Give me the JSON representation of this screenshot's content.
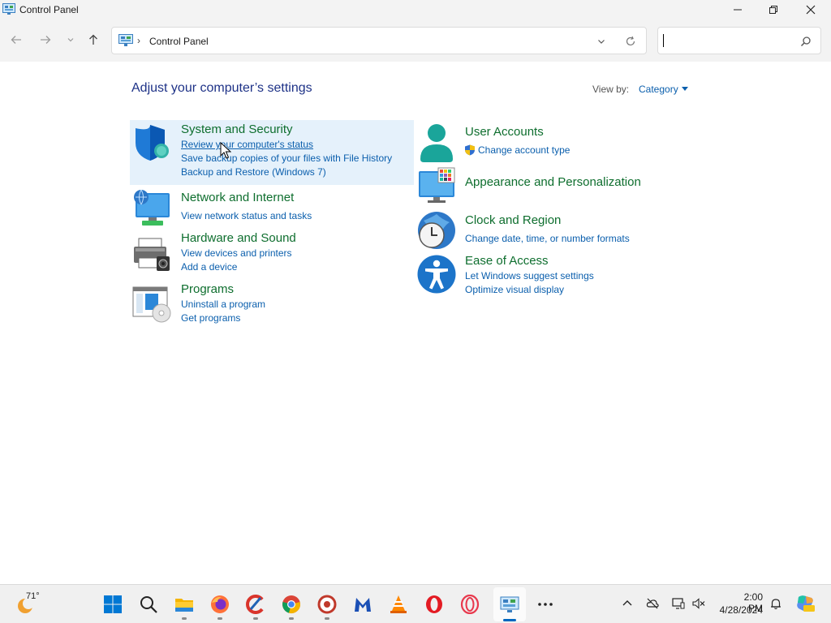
{
  "window": {
    "title": "Control Panel"
  },
  "address": {
    "crumb": "Control Panel",
    "separator": "›"
  },
  "search": {
    "placeholder": "",
    "value": ""
  },
  "main": {
    "heading": "Adjust your computer’s settings",
    "view_by_label": "View by:",
    "view_by_value": "Category"
  },
  "categories": {
    "system_security": {
      "title": "System and Security",
      "links": [
        "Review your computer's status",
        "Save backup copies of your files with File History",
        "Backup and Restore (Windows 7)"
      ]
    },
    "network": {
      "title": "Network and Internet",
      "links": [
        "View network status and tasks"
      ]
    },
    "hardware": {
      "title": "Hardware and Sound",
      "links": [
        "View devices and printers",
        "Add a device"
      ]
    },
    "programs": {
      "title": "Programs",
      "links": [
        "Uninstall a program",
        "Get programs"
      ]
    },
    "user_accounts": {
      "title": "User Accounts",
      "links": [
        "Change account type"
      ]
    },
    "appearance": {
      "title": "Appearance and Personalization",
      "links": []
    },
    "clock": {
      "title": "Clock and Region",
      "links": [
        "Change date, time, or number formats"
      ]
    },
    "ease": {
      "title": "Ease of Access",
      "links": [
        "Let Windows suggest settings",
        "Optimize visual display"
      ]
    }
  },
  "taskbar": {
    "weather_temp": "71°",
    "apps": [
      "start-icon",
      "search-icon",
      "file-explorer-icon",
      "firefox-icon",
      "ccleaner-icon",
      "chrome-icon",
      "app-icon",
      "malwarebytes-icon",
      "vlc-icon",
      "opera-icon",
      "opera-gx-icon",
      "control-panel-icon",
      "more-icon"
    ],
    "time": "2:00 PM",
    "date": "4/28/2024"
  },
  "colors": {
    "accent": "#0067c0",
    "category_title": "#0e6e2e",
    "link": "#0b5fad",
    "heading": "#1e3287",
    "highlight": "#e5f1fb"
  }
}
